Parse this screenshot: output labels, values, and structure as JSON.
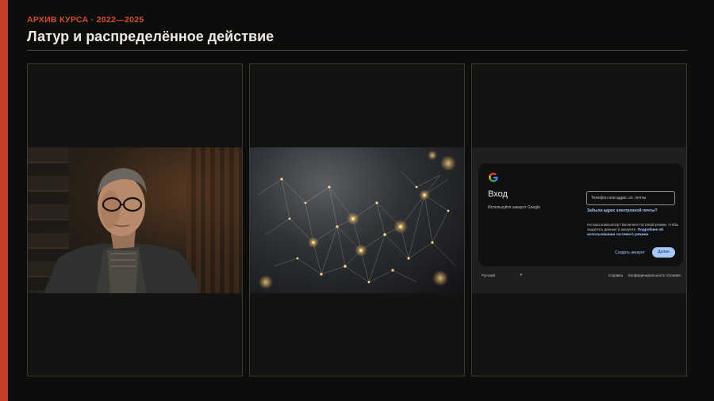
{
  "header": {
    "kicker": "АРХИВ КУРСА · 2022—2025",
    "title": "Латур и распределённое действие"
  },
  "colors": {
    "accent": "#c2402a",
    "background": "#0d0d0c",
    "panel": "#131312",
    "link": "#a8c7fa"
  },
  "panels": [
    {
      "image": "portrait-of-older-man-with-glasses"
    },
    {
      "image": "glowing-network-nodes"
    },
    {
      "image": "google-sign-in-screen",
      "signin": {
        "heading": "Вход",
        "subtitle": "Используйте аккаунт Google",
        "input_placeholder": "Телефон или адрес эл. почты",
        "forgot_email": "Забыли адрес электронной почты?",
        "guest_text": "Не ваш компьютер? Включите гостевой режим, чтобы защитить данные в аккаунте.",
        "guest_link": "Подробнее об использовании гостевого режима",
        "create_account": "Создать аккаунт",
        "next": "Далее",
        "language": "Русский",
        "help": "Справка",
        "privacy": "Конфиденциальность",
        "terms": "Условия"
      }
    }
  ]
}
